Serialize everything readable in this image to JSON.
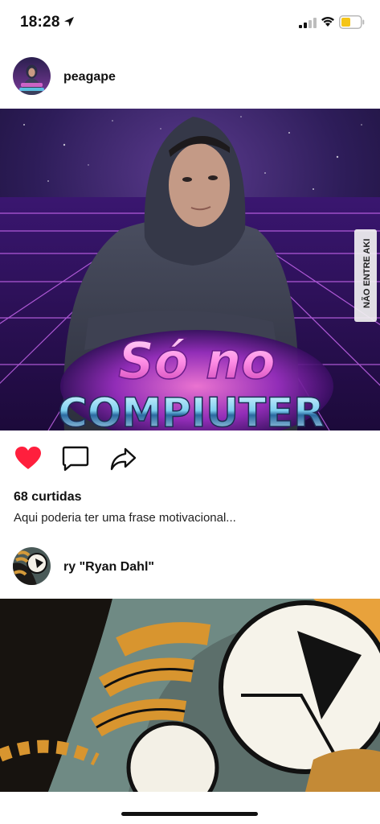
{
  "status_bar": {
    "time": "18:28",
    "icons": [
      "location-arrow-icon",
      "signal-icon",
      "wifi-icon",
      "battery-icon"
    ],
    "battery_color": "#f5c518"
  },
  "posts": [
    {
      "username": "peagape",
      "avatar_icon": "profile-avatar",
      "image_text": {
        "line1": "Só no",
        "line2": "COMPIUTER",
        "watermark": "NÃO ENTRE AKI"
      },
      "like_icon": "heart-icon",
      "liked": true,
      "like_color": "#ff1f3d",
      "comment_icon": "comment-icon",
      "share_icon": "share-icon",
      "likes_text": "68 curtidas",
      "caption": "Aqui poderia ter uma frase motivacional..."
    },
    {
      "username": "ry \"Ryan Dahl\"",
      "avatar_icon": "profile-avatar"
    }
  ]
}
